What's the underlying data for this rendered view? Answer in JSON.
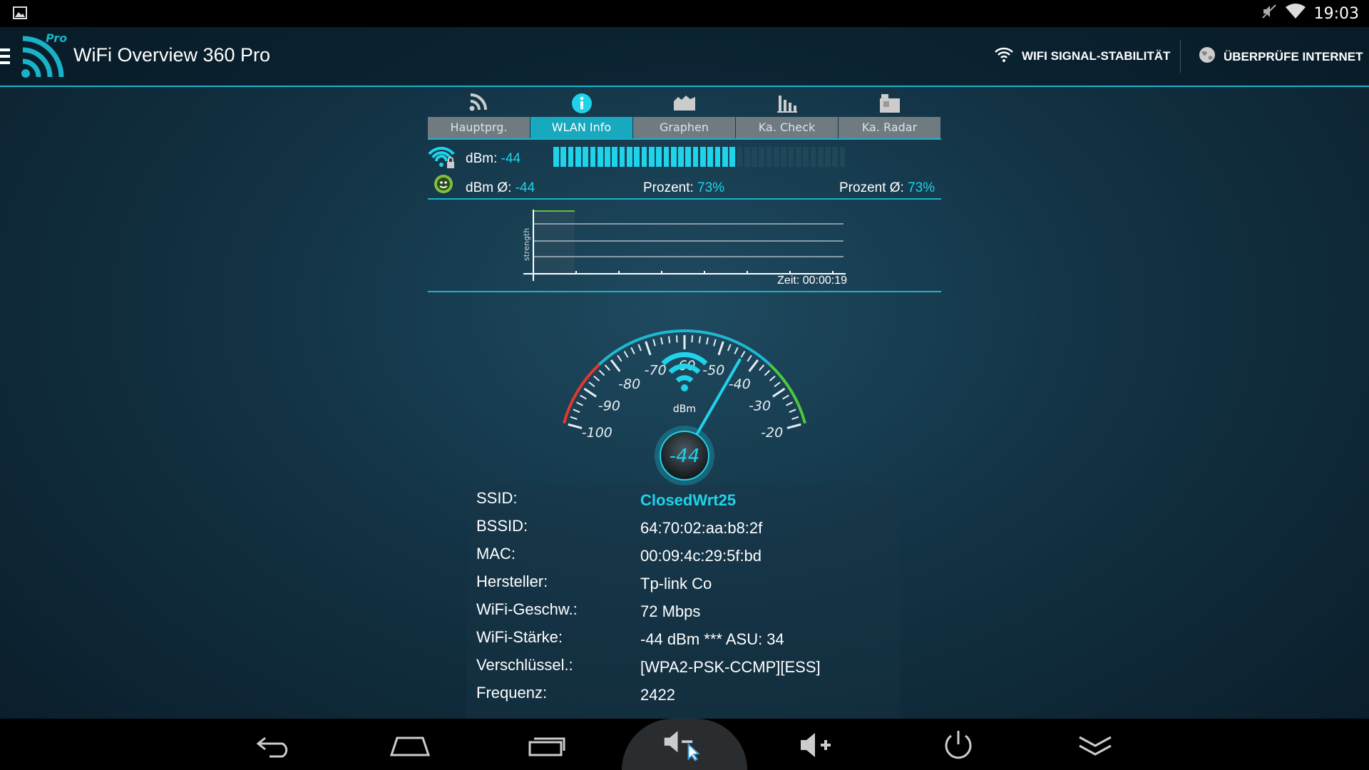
{
  "status_bar": {
    "time": "19:03"
  },
  "app_bar": {
    "title": "WiFi Overview 360 Pro",
    "logo_badge": "Pro",
    "action_stability": "WIFI SIGNAL-STABILITÄT",
    "action_internet": "ÜBERPRÜFE INTERNET"
  },
  "tabs": [
    {
      "label": "Hauptprg.",
      "icon": "rss-icon",
      "active": false
    },
    {
      "label": "WLAN Info",
      "icon": "info-icon",
      "active": true
    },
    {
      "label": "Graphen",
      "icon": "area-chart-icon",
      "active": false
    },
    {
      "label": "Ka. Check",
      "icon": "bar-chart-icon",
      "active": false
    },
    {
      "label": "Ka. Radar",
      "icon": "radar-icon",
      "active": false
    }
  ],
  "signal": {
    "dbm_label": "dBm:",
    "dbm_value": "-44",
    "avg_label": "dBm Ø:",
    "avg_value": "-44",
    "percent_label": "Prozent:",
    "percent_value": "73%",
    "percent_avg_label": "Prozent Ø:",
    "percent_avg_value": "73%",
    "bar_fill_fraction": 0.73
  },
  "mini_graph": {
    "ylabel": "strength",
    "time_label": "Zeit: 00:00:19"
  },
  "gauge": {
    "unit": "dBm",
    "value": "-44",
    "value_num": -44,
    "min": -100,
    "max": -20,
    "ticks": [
      "-100",
      "-90",
      "-80",
      "-70",
      "-60",
      "-50",
      "-40",
      "-30",
      "-20"
    ]
  },
  "info": [
    {
      "label": "SSID:",
      "value": "ClosedWrt25"
    },
    {
      "label": "BSSID:",
      "value": "64:70:02:aa:b8:2f"
    },
    {
      "label": "MAC:",
      "value": "00:09:4c:29:5f:bd"
    },
    {
      "label": "Hersteller:",
      "value": "Tp-link Co"
    },
    {
      "label": "WiFi-Geschw.:",
      "value": "72 Mbps"
    },
    {
      "label": "WiFi-Stärke:",
      "value": "-44 dBm *** ASU: 34"
    },
    {
      "label": "Verschlüssel.:",
      "value": "[WPA2-PSK-CCMP][ESS]"
    },
    {
      "label": "Frequenz:",
      "value": "2422"
    }
  ],
  "colors": {
    "accent": "#19b3c9",
    "highlight": "#1fd3ea",
    "tab_inactive": "#6f7a81"
  }
}
